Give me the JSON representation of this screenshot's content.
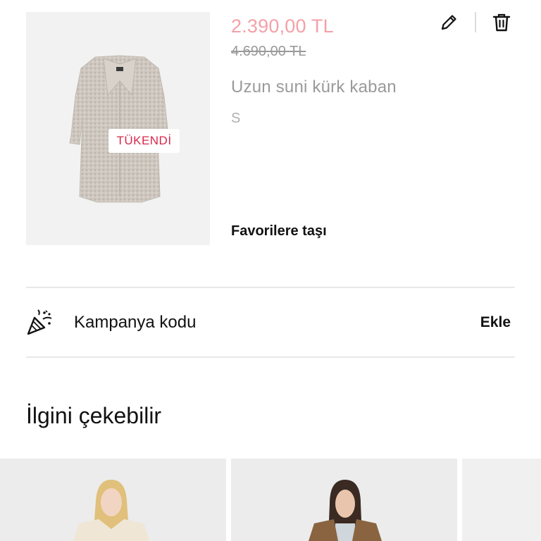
{
  "cart_item": {
    "price_current": "2.390,00 TL",
    "price_old": "4.690,00 TL",
    "name": "Uzun suni kürk kaban",
    "size": "S",
    "sold_out_badge": "TÜKENDİ",
    "move_to_favorites": "Favorilere taşı",
    "icons": [
      "pencil-icon",
      "trash-icon"
    ]
  },
  "promo": {
    "icon": "party-popper-icon",
    "label": "Kampanya kodu",
    "action": "Ekle"
  },
  "recommendations": {
    "title": "İlgini çekebilir"
  },
  "colors": {
    "price_current": "#f4a0a8",
    "sold_out": "#d9264a",
    "muted_text": "#9a9a9a",
    "divider": "#e8e8e8"
  }
}
